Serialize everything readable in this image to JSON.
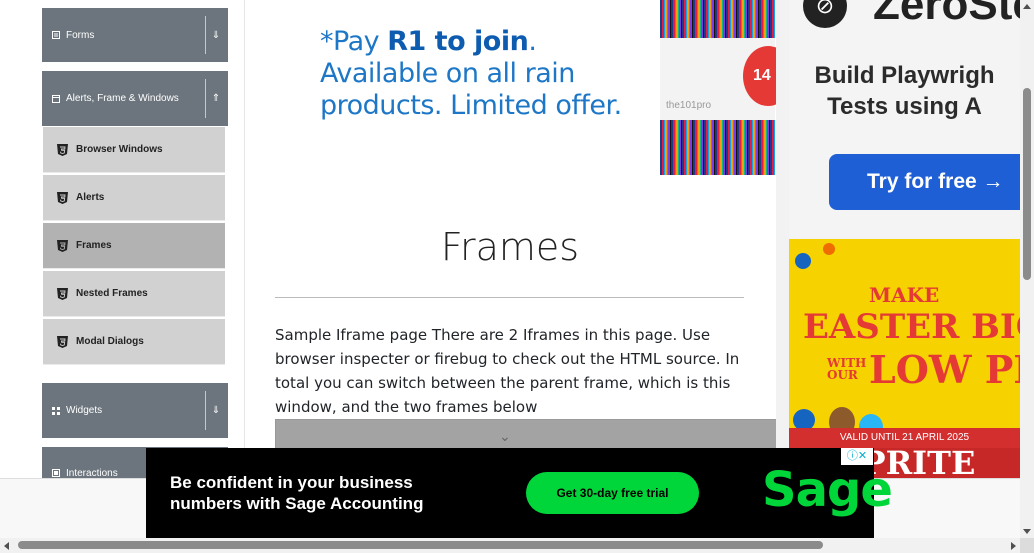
{
  "sidebar": {
    "groups": [
      {
        "label": "Forms",
        "icon": "form-icon",
        "arrow": "⇓"
      },
      {
        "label": "Alerts, Frame & Windows",
        "icon": "window-icon",
        "arrow": "⇑"
      },
      {
        "label": "Widgets",
        "icon": "grid-icon",
        "arrow": "⇓"
      },
      {
        "label": "Interactions",
        "icon": "interaction-icon",
        "arrow": ""
      }
    ],
    "items": [
      {
        "label": "Browser Windows",
        "icon": "html5-icon"
      },
      {
        "label": "Alerts",
        "icon": "html5-icon"
      },
      {
        "label": "Frames",
        "icon": "html5-icon",
        "active": true
      },
      {
        "label": "Nested Frames",
        "icon": "html5-icon"
      },
      {
        "label": "Modal Dialogs",
        "icon": "html5-icon"
      }
    ]
  },
  "ad_top": {
    "line1_pre": "*Pay ",
    "line1_bold": "R1 to join",
    "line1_post": ".",
    "line2": "Available on all rain",
    "line3": "products. Limited offer.",
    "brand": "the101pro",
    "badge": "14"
  },
  "main": {
    "title": "Frames",
    "description": "Sample Iframe page There are 2 Iframes in this page. Use browser inspecter or firebug to check out the HTML source. In total you can switch between the parent frame, which is this window, and the two frames below"
  },
  "ad_right": {
    "logo_text": "ZeroSte",
    "tagline1": "Build Playwrigh",
    "tagline2": "Tests using A",
    "button_label": "Try for free →"
  },
  "ad_easter": {
    "line1": "MAKE",
    "line2": "EASTER BIGG",
    "line3_small": "WITH OUR",
    "line3_big": "LOW PRIC",
    "valid": "VALID UNTIL 21 APRIL 2025",
    "brand": "OPRITE"
  },
  "ad_bottom": {
    "line1": "Be confident in your business",
    "line2": "numbers with Sage Accounting",
    "cta": "Get 30-day free trial",
    "logo": "Sage",
    "adchoice": "ⓘ✕"
  },
  "colors": {
    "sidebar_group": "#6c757d",
    "sidebar_item": "#d1d1d1",
    "sidebar_item_active": "#b2b2b2",
    "ad_blue": "#1e77c6",
    "sage_green": "#00d639"
  }
}
